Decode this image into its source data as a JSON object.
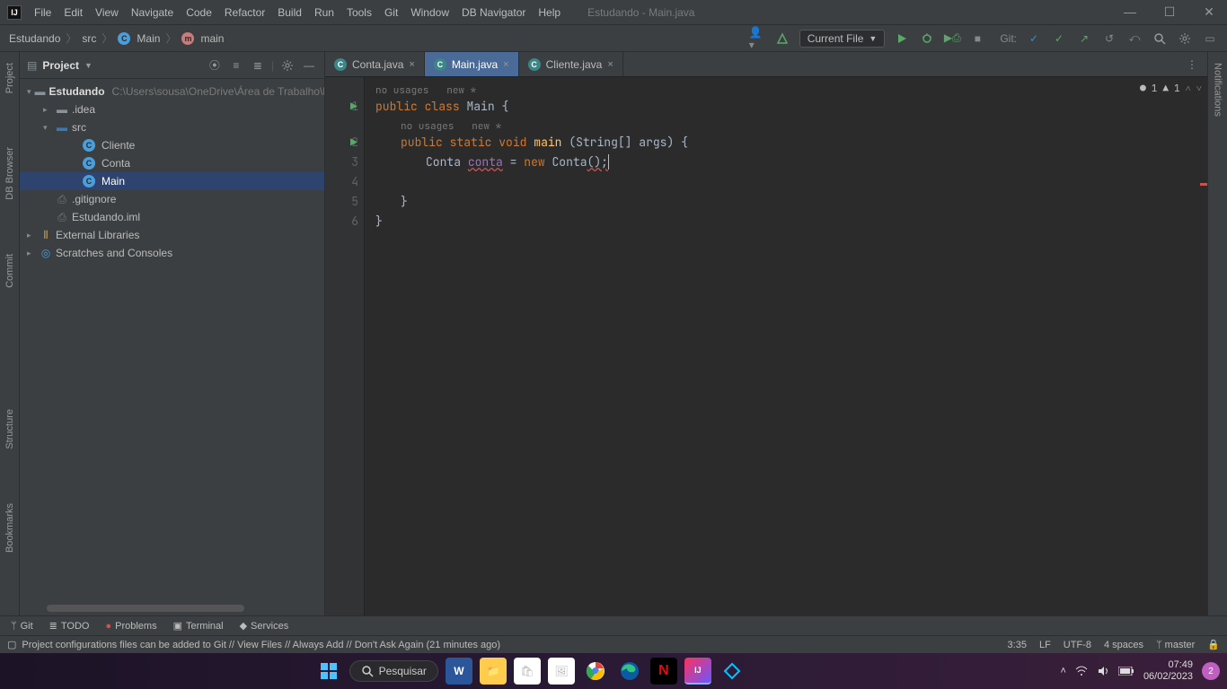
{
  "window": {
    "title": "Estudando - Main.java",
    "menus": [
      "File",
      "Edit",
      "View",
      "Navigate",
      "Code",
      "Refactor",
      "Build",
      "Run",
      "Tools",
      "Git",
      "Window",
      "DB Navigator",
      "Help"
    ]
  },
  "breadcrumbs": {
    "project": "Estudando",
    "src": "src",
    "class": "Main",
    "method": "main"
  },
  "toolbar": {
    "run_config": "Current File",
    "git_label": "Git:",
    "errors": "1",
    "warnings": "1"
  },
  "project_pane": {
    "title": "Project",
    "root": "Estudando",
    "root_path": "C:\\Users\\sousa\\OneDrive\\Área de Trabalho\\F",
    "idea": ".idea",
    "src": "src",
    "files": {
      "cliente": "Cliente",
      "conta": "Conta",
      "main": "Main"
    },
    "gitignore": ".gitignore",
    "iml": "Estudando.iml",
    "ext_lib": "External Libraries",
    "scratches": "Scratches and Consoles"
  },
  "tabs": {
    "conta": "Conta.java",
    "main": "Main.java",
    "cliente": "Cliente.java"
  },
  "editor": {
    "hint1_usages": "no usages",
    "hint1_new": "new *",
    "hint2_usages": "no usages",
    "hint2_new": "new *",
    "l1": {
      "public": "public",
      "class": "class",
      "name": "Main",
      "brace": "{"
    },
    "l2": {
      "public": "public",
      "static": "static",
      "void": "void",
      "main": "main",
      "sig": "(String[] args) {"
    },
    "l3": {
      "type": "Conta",
      "var": "conta",
      "eq": "=",
      "new": "new",
      "ctor": "Conta",
      "tail": "();"
    },
    "l5": "}",
    "l6": "}",
    "line_nums": [
      "1",
      "2",
      "3",
      "4",
      "5",
      "6"
    ]
  },
  "left_gutter": {
    "project": "Project",
    "db": "DB Browser",
    "commit": "Commit",
    "structure": "Structure",
    "bookmarks": "Bookmarks"
  },
  "right_gutter": {
    "notifications": "Notifications"
  },
  "bottom": {
    "git": "Git",
    "todo": "TODO",
    "problems": "Problems",
    "terminal": "Terminal",
    "services": "Services"
  },
  "status": {
    "message": "Project configurations files can be added to Git // View Files // Always Add // Don't Ask Again (21 minutes ago)",
    "pos": "3:35",
    "eol": "LF",
    "enc": "UTF-8",
    "indent": "4 spaces",
    "branch": "master"
  },
  "taskbar": {
    "search": "Pesquisar",
    "time": "07:49",
    "date": "06/02/2023",
    "notif": "2"
  }
}
